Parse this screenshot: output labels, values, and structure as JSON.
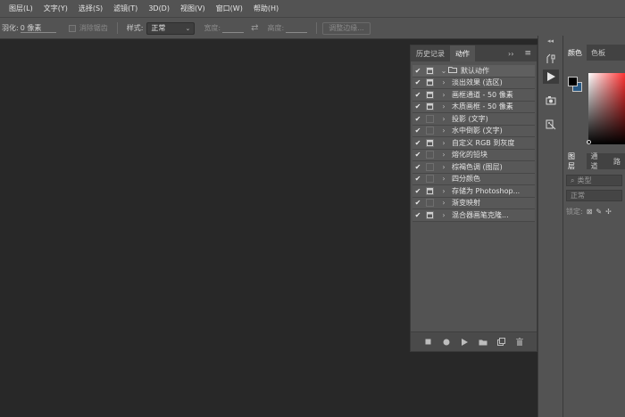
{
  "menu": [
    "图层(L)",
    "文字(Y)",
    "选择(S)",
    "滤镜(T)",
    "3D(D)",
    "视图(V)",
    "窗口(W)",
    "帮助(H)"
  ],
  "options_bar": {
    "feather_label": "羽化:",
    "feather_value": "0 像素",
    "antialias_label": "消除锯齿",
    "style_label": "样式:",
    "style_value": "正常",
    "width_label": "宽度:",
    "height_label": "高度:",
    "refine_edge_button": "调整边缘..."
  },
  "actions_panel": {
    "tabs": [
      "历史记录",
      "动作"
    ],
    "active_tab": "动作",
    "menu_glyph": "≡",
    "collapse_glyph": "››",
    "rows": [
      {
        "label": "默认动作",
        "checked": true,
        "is_set": true,
        "toggle": true
      },
      {
        "label": "淡出效果 (选区)",
        "checked": true,
        "is_set": false,
        "toggle": true
      },
      {
        "label": "画框通道 - 50 像素",
        "checked": true,
        "is_set": false,
        "toggle": true
      },
      {
        "label": "木质画框 - 50 像素",
        "checked": true,
        "is_set": false,
        "toggle": true
      },
      {
        "label": "投影 (文字)",
        "checked": true,
        "is_set": false,
        "toggle": false
      },
      {
        "label": "水中倒影 (文字)",
        "checked": true,
        "is_set": false,
        "toggle": false
      },
      {
        "label": "自定义 RGB 到灰度",
        "checked": true,
        "is_set": false,
        "toggle": true
      },
      {
        "label": "熔化的铅块",
        "checked": true,
        "is_set": false,
        "toggle": false
      },
      {
        "label": "棕褐色调 (图层)",
        "checked": true,
        "is_set": false,
        "toggle": false
      },
      {
        "label": "四分颜色",
        "checked": true,
        "is_set": false,
        "toggle": false
      },
      {
        "label": "存储为 Photoshop...",
        "checked": true,
        "is_set": false,
        "toggle": true
      },
      {
        "label": "渐变映射",
        "checked": true,
        "is_set": false,
        "toggle": false
      },
      {
        "label": "混合器画笔克隆...",
        "checked": true,
        "is_set": false,
        "toggle": true
      }
    ],
    "footer_icons": [
      "stop-icon",
      "record-icon",
      "play-icon",
      "new-set-icon",
      "new-action-icon",
      "delete-icon"
    ]
  },
  "dock_icons": [
    "history-brush-icon",
    "play-icon",
    "clone-source-icon",
    "properties-icon"
  ],
  "color_panel": {
    "tabs": [
      "颜色",
      "色板"
    ],
    "foreground_color": "#000000",
    "background_color": "#2a5b86"
  },
  "layers_panel": {
    "tabs": [
      "图层",
      "通道",
      "路"
    ],
    "kind_filter": "类型",
    "blend_mode": "正常",
    "lock_label": "锁定:"
  }
}
